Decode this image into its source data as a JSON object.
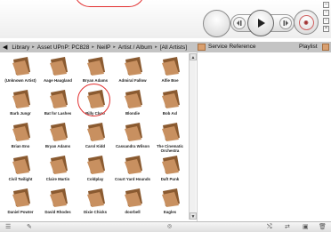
{
  "breadcrumb": {
    "items": [
      "Library",
      "Asset UPnP: PC828",
      "NeilP",
      "Artist / Album",
      "[All Artists]"
    ]
  },
  "right_panel": {
    "service_reference": "Service Reference",
    "playlist": "Playlist"
  },
  "artists": [
    "(Unknown Artist)",
    "Aage Haugland",
    "Bryan Adams",
    "Admiral Fallow",
    "Alfie Boe",
    "Barb Jungr",
    "Bat for Lashes",
    "Billy Clyro",
    "Blondie",
    "Bob Axl",
    "Brian Eno",
    "Bryan Adams",
    "Carol Kidd",
    "Cassandra Wilson",
    "The Cinematic Orchestra",
    "Civil Twilight",
    "Claire Martin",
    "Coldplay",
    "Court Yard Hounds",
    "Daft Punk",
    "Daniel Powter",
    "David Rhodes",
    "Dixie Chicks",
    "doorbell",
    "Eagles"
  ],
  "colors": {
    "folder": "#c89060",
    "folder_dark": "#8a5a30",
    "annotation_red": "#e23030",
    "nav_bar": "#c4c4c4"
  },
  "icons": {
    "transport": [
      "prev-icon",
      "play-icon",
      "next-icon",
      "record-icon"
    ],
    "bottom_left": [
      "list-icon",
      "tool-icon"
    ],
    "bottom_right": [
      "shuffle-icon",
      "repeat-icon",
      "save-icon",
      "trash-icon"
    ]
  }
}
